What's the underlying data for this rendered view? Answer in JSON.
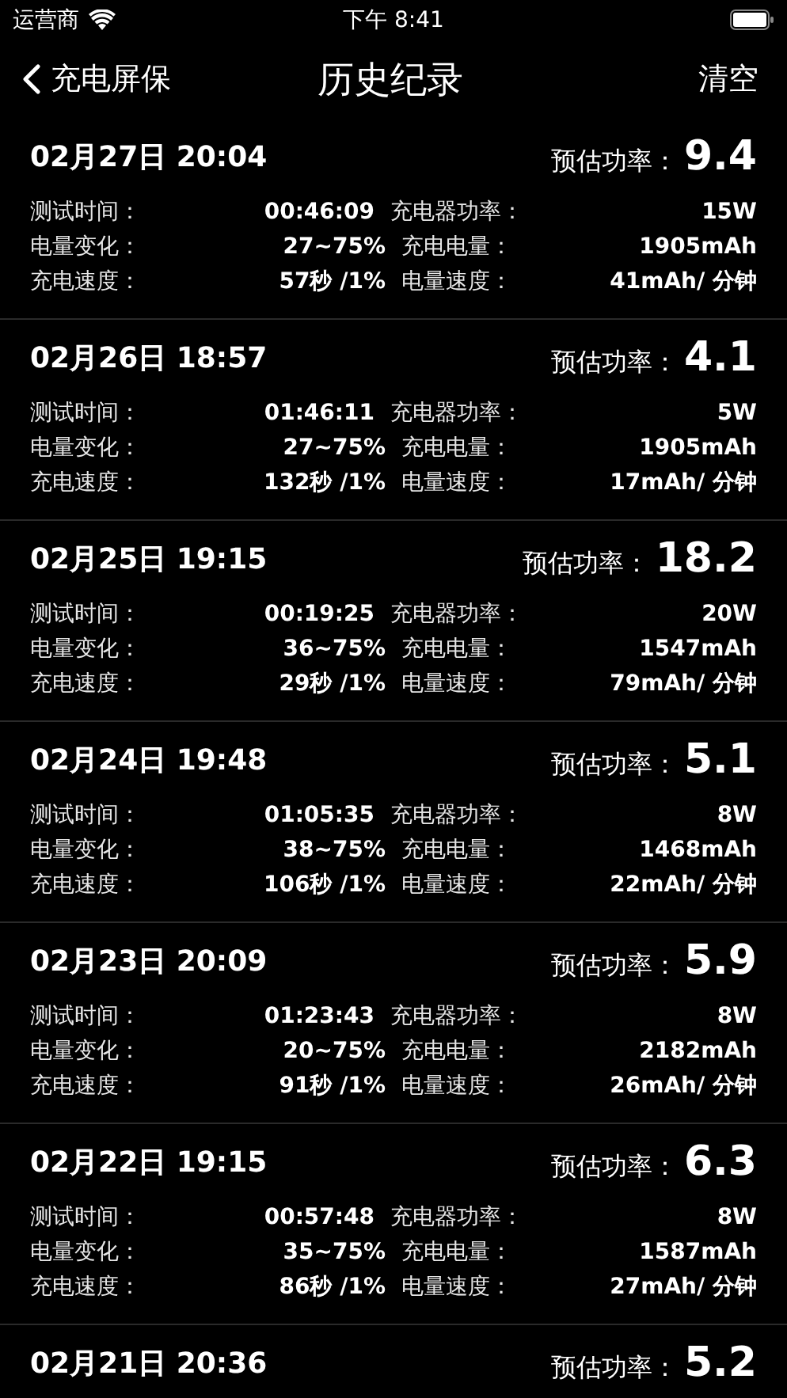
{
  "status_bar": {
    "carrier": "运营商",
    "time": "下午 8:41"
  },
  "nav": {
    "back": "充电屏保",
    "title": "历史纪录",
    "action": "清空"
  },
  "records": [
    {
      "date": "02月27日 20:04",
      "power_label": "预估功率：",
      "power": "9.4",
      "rows": [
        [
          "测试时间：",
          "00:46:09",
          "充电器功率：",
          "15W"
        ],
        [
          "电量变化：",
          "27~75%",
          "充电电量：",
          "1905mAh"
        ],
        [
          "充电速度：",
          "57秒 /1%",
          "电量速度：",
          "41mAh/ 分钟"
        ]
      ]
    },
    {
      "date": "02月26日 18:57",
      "power_label": "预估功率：",
      "power": "4.1",
      "rows": [
        [
          "测试时间：",
          "01:46:11",
          "充电器功率：",
          "5W"
        ],
        [
          "电量变化：",
          "27~75%",
          "充电电量：",
          "1905mAh"
        ],
        [
          "充电速度：",
          "132秒 /1%",
          "电量速度：",
          "17mAh/ 分钟"
        ]
      ]
    },
    {
      "date": "02月25日 19:15",
      "power_label": "预估功率：",
      "power": "18.2",
      "rows": [
        [
          "测试时间：",
          "00:19:25",
          "充电器功率：",
          "20W"
        ],
        [
          "电量变化：",
          "36~75%",
          "充电电量：",
          "1547mAh"
        ],
        [
          "充电速度：",
          "29秒 /1%",
          "电量速度：",
          "79mAh/ 分钟"
        ]
      ]
    },
    {
      "date": "02月24日 19:48",
      "power_label": "预估功率：",
      "power": "5.1",
      "rows": [
        [
          "测试时间：",
          "01:05:35",
          "充电器功率：",
          "8W"
        ],
        [
          "电量变化：",
          "38~75%",
          "充电电量：",
          "1468mAh"
        ],
        [
          "充电速度：",
          "106秒 /1%",
          "电量速度：",
          "22mAh/ 分钟"
        ]
      ]
    },
    {
      "date": "02月23日 20:09",
      "power_label": "预估功率：",
      "power": "5.9",
      "rows": [
        [
          "测试时间：",
          "01:23:43",
          "充电器功率：",
          "8W"
        ],
        [
          "电量变化：",
          "20~75%",
          "充电电量：",
          "2182mAh"
        ],
        [
          "充电速度：",
          "91秒 /1%",
          "电量速度：",
          "26mAh/ 分钟"
        ]
      ]
    },
    {
      "date": "02月22日 19:15",
      "power_label": "预估功率：",
      "power": "6.3",
      "rows": [
        [
          "测试时间：",
          "00:57:48",
          "充电器功率：",
          "8W"
        ],
        [
          "电量变化：",
          "35~75%",
          "充电电量：",
          "1587mAh"
        ],
        [
          "充电速度：",
          "86秒 /1%",
          "电量速度：",
          "27mAh/ 分钟"
        ]
      ]
    },
    {
      "date": "02月21日 20:36",
      "power_label": "预估功率：",
      "power": "5.2"
    }
  ]
}
